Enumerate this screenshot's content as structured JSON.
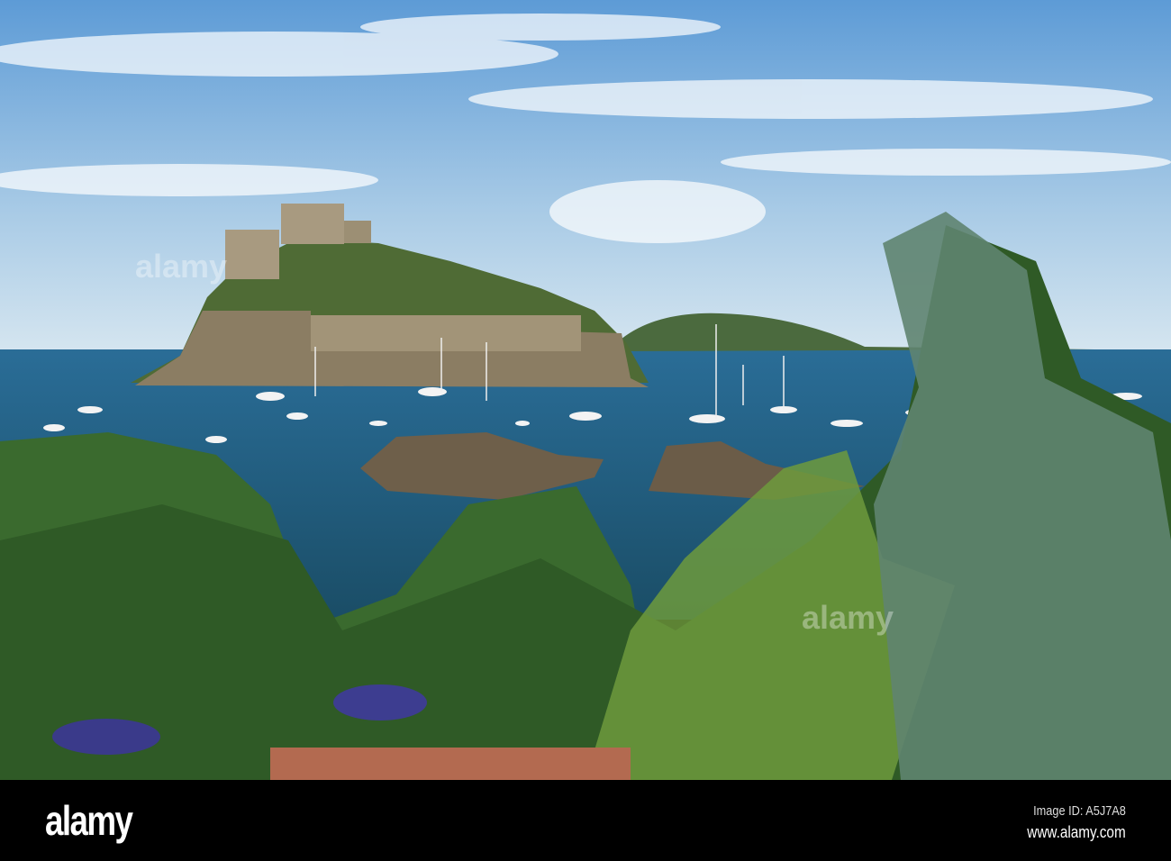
{
  "photo": {
    "colors": {
      "sky_top": "#5d9bd6",
      "sky_bottom": "#cfe2ef",
      "sea": "#1f5f8a",
      "rock": "#7a6e58",
      "green": "#3d6b2c"
    }
  },
  "footer": {
    "logo": "alamy",
    "image_id": "Image ID: A5J7A8",
    "url": "www.alamy.com"
  }
}
